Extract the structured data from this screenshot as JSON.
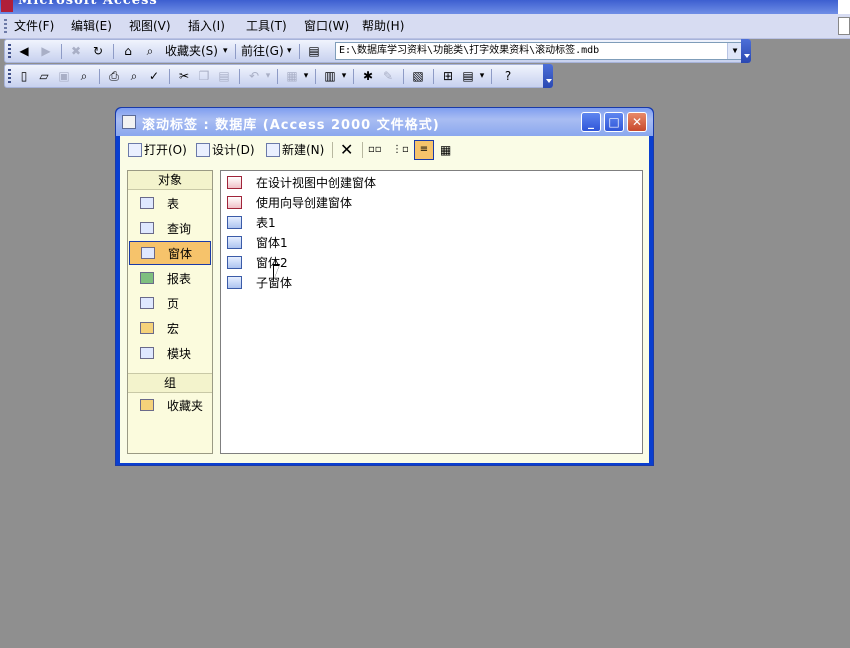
{
  "app": {
    "title": "Microsoft Access"
  },
  "menubar": {
    "items": [
      {
        "label": "文件(F)"
      },
      {
        "label": "编辑(E)"
      },
      {
        "label": "视图(V)"
      },
      {
        "label": "插入(I)"
      },
      {
        "label": "工具(T)"
      },
      {
        "label": "窗口(W)"
      },
      {
        "label": "帮助(H)"
      }
    ]
  },
  "web_toolbar": {
    "favorites_label": "收藏夹(S)",
    "goto_label": "前往(G)",
    "address": "E:\\数据库学习资料\\功能类\\打字效果资料\\滚动标签.mdb"
  },
  "db_window": {
    "title": "滚动标签 : 数据库 (Access 2000 文件格式)",
    "toolbar": {
      "open_label": "打开(O)",
      "design_label": "设计(D)",
      "new_label": "新建(N)"
    },
    "objects_header": "对象",
    "objects": [
      {
        "label": "表",
        "icon": "table-icon"
      },
      {
        "label": "查询",
        "icon": "query-icon"
      },
      {
        "label": "窗体",
        "icon": "form-icon",
        "selected": true
      },
      {
        "label": "报表",
        "icon": "report-icon"
      },
      {
        "label": "页",
        "icon": "page-icon"
      },
      {
        "label": "宏",
        "icon": "macro-icon"
      },
      {
        "label": "模块",
        "icon": "module-icon"
      }
    ],
    "groups_header": "组",
    "groups": [
      {
        "label": "收藏夹",
        "icon": "favorites-folder-icon"
      }
    ],
    "list_items": [
      {
        "label": "在设计视图中创建窗体",
        "icon": "wizard-icon"
      },
      {
        "label": "使用向导创建窗体",
        "icon": "wizard-icon"
      },
      {
        "label": "表1",
        "icon": "form-icon"
      },
      {
        "label": "窗体1",
        "icon": "form-icon"
      },
      {
        "label": "窗体2",
        "icon": "form-icon"
      },
      {
        "label": "子窗体",
        "icon": "form-icon"
      }
    ]
  }
}
